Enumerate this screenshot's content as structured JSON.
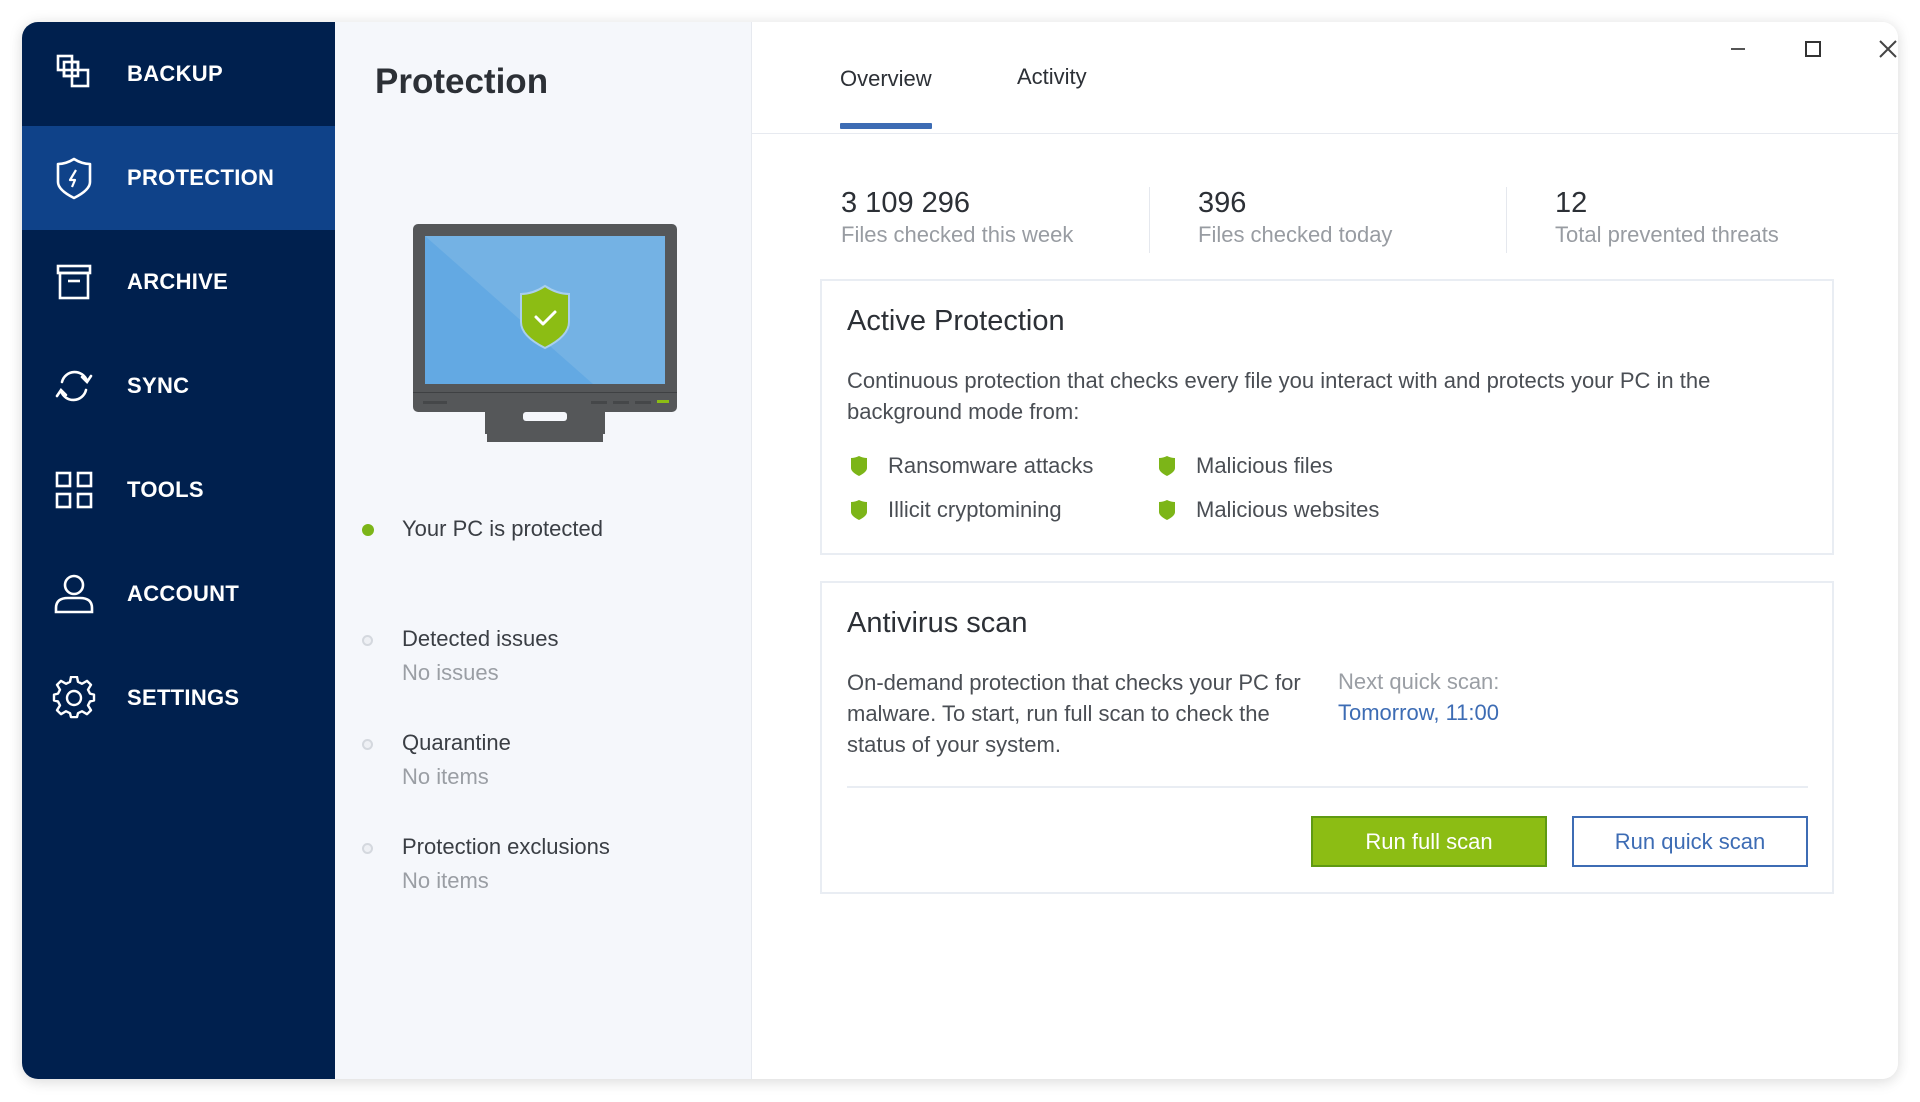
{
  "window": {
    "controls": {
      "minimize": "minimize",
      "maximize": "maximize",
      "close": "close"
    }
  },
  "sidebar": {
    "items": [
      {
        "label": "BACKUP",
        "icon": "backup-icon",
        "active": false
      },
      {
        "label": "PROTECTION",
        "icon": "shield-bolt-icon",
        "active": true
      },
      {
        "label": "ARCHIVE",
        "icon": "archive-box-icon",
        "active": false
      },
      {
        "label": "SYNC",
        "icon": "sync-icon",
        "active": false
      },
      {
        "label": "TOOLS",
        "icon": "tools-grid-icon",
        "active": false
      },
      {
        "label": "ACCOUNT",
        "icon": "user-icon",
        "active": false
      },
      {
        "label": "SETTINGS",
        "icon": "gear-icon",
        "active": false
      }
    ]
  },
  "middle": {
    "title": "Protection",
    "status": {
      "label": "Your PC is protected",
      "color": "#7cb518"
    },
    "sections": [
      {
        "title": "Detected issues",
        "value": "No issues"
      },
      {
        "title": "Quarantine",
        "value": "No items"
      },
      {
        "title": "Protection exclusions",
        "value": "No items"
      }
    ]
  },
  "tabs": [
    {
      "label": "Overview",
      "active": true
    },
    {
      "label": "Activity",
      "active": false
    }
  ],
  "stats": [
    {
      "value": "3 109 296",
      "label": "Files checked this week"
    },
    {
      "value": "396",
      "label": "Files checked today"
    },
    {
      "value": "12",
      "label": "Total prevented threats"
    }
  ],
  "active_protection": {
    "title": "Active Protection",
    "description": "Continuous protection that checks every file you interact with and protects your PC in the background mode from:",
    "features": [
      "Ransomware attacks",
      "Malicious files",
      "Illicit cryptomining",
      "Malicious websites"
    ]
  },
  "antivirus": {
    "title": "Antivirus scan",
    "description": "On-demand protection that checks your PC for malware. To start, run full scan to check the status of your system.",
    "next_scan_label": "Next quick scan:",
    "next_scan_value": "Tomorrow, 11:00",
    "run_full_label": "Run full scan",
    "run_quick_label": "Run quick scan"
  },
  "colors": {
    "sidebar_bg": "#00204e",
    "sidebar_active": "#0f4289",
    "accent_green": "#8cbd14",
    "accent_blue": "#3d6cb4"
  }
}
